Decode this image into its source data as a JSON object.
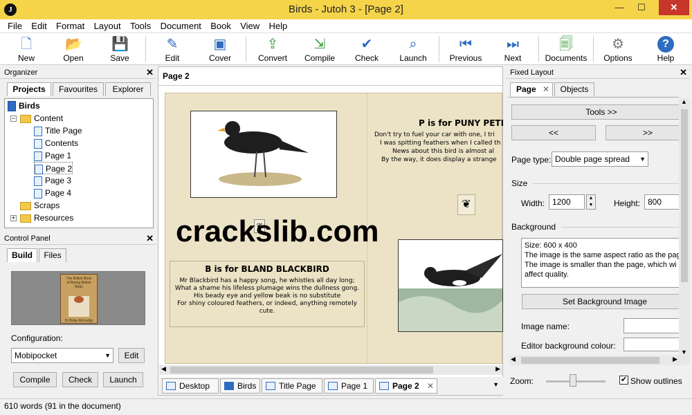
{
  "window": {
    "title": "Birds - Jutoh 3 - [Page 2]",
    "app_letter": "J",
    "minimize": "—",
    "maximize": "☐",
    "close": "✕"
  },
  "menu": [
    "File",
    "Edit",
    "Format",
    "Layout",
    "Tools",
    "Document",
    "Book",
    "View",
    "Help"
  ],
  "toolbar": [
    {
      "label": "New",
      "icon": "new-icon"
    },
    {
      "label": "Open",
      "icon": "open-folder-icon"
    },
    {
      "label": "Save",
      "icon": "save-icon"
    },
    {
      "label": "Edit",
      "icon": "edit-icon"
    },
    {
      "label": "Cover",
      "icon": "cover-icon"
    },
    {
      "label": "Convert",
      "icon": "convert-icon"
    },
    {
      "label": "Compile",
      "icon": "compile-icon"
    },
    {
      "label": "Check",
      "icon": "check-icon"
    },
    {
      "label": "Launch",
      "icon": "launch-icon"
    },
    {
      "label": "Previous",
      "icon": "previous-icon"
    },
    {
      "label": "Next",
      "icon": "next-icon"
    },
    {
      "label": "Documents",
      "icon": "documents-icon"
    },
    {
      "label": "Options",
      "icon": "options-icon"
    },
    {
      "label": "Help",
      "icon": "help-icon"
    }
  ],
  "organizer": {
    "title": "Organizer",
    "tabs": [
      "Projects",
      "Favourites",
      "Explorer"
    ],
    "tree": [
      {
        "label": "Birds",
        "type": "book"
      },
      {
        "label": "Content",
        "type": "folder"
      },
      {
        "label": "Title Page",
        "type": "page"
      },
      {
        "label": "Contents",
        "type": "page"
      },
      {
        "label": "Page 1",
        "type": "page"
      },
      {
        "label": "Page 2",
        "type": "page"
      },
      {
        "label": "Page 3",
        "type": "page"
      },
      {
        "label": "Page 4",
        "type": "page"
      },
      {
        "label": "Scraps",
        "type": "folder"
      },
      {
        "label": "Resources",
        "type": "folder"
      }
    ]
  },
  "control_panel": {
    "title": "Control Panel",
    "tabs": [
      "Build",
      "Files"
    ],
    "cover_lines": [
      "The British Book",
      "of Boring British",
      "Birds",
      "Dr Boba McFaddy"
    ],
    "config_label": "Configuration:",
    "config_value": "Mobipocket",
    "edit": "Edit",
    "compile": "Compile",
    "check": "Check",
    "launch": "Launch"
  },
  "editor": {
    "title": "Page 2",
    "left_heading": "B is for BLAND BLACKBIRD",
    "left_text": [
      "Mr Blackbird has a happy song, he whistles all day long;",
      "What a shame his lifeless plumage wins the dullness gong.",
      "His beady eye and yellow beak is no substitute",
      "For shiny coloured feathers, or indeed, anything remotely",
      "cute."
    ],
    "right_heading": "P is for PUNY PETI",
    "right_text": [
      "Don't try to fuel your car with one, I tri",
      "I was spitting feathers when I called th",
      "News about this bird is almost al",
      "By the way, it does display a strange"
    ],
    "watermark": "crackslib.com",
    "tabs": [
      "Desktop",
      "Birds",
      "Title Page",
      "Page 1",
      "Page 2"
    ]
  },
  "fixed_layout": {
    "title": "Fixed Layout",
    "tabs": [
      "Page",
      "Objects"
    ],
    "tools": "Tools >>",
    "prev": "<<",
    "next": ">>",
    "page_type_label": "Page type:",
    "page_type_value": "Double page spread",
    "size_label": "Size",
    "width_label": "Width:",
    "width_value": "1200",
    "height_label": "Height:",
    "height_value": "800",
    "background_label": "Background",
    "bg_info": [
      "Size: 600 x 400",
      "The image is the same aspect ratio as the pag",
      "The image is smaller than the page, which wi",
      "affect quality."
    ],
    "set_bg": "Set Background Image",
    "image_name_label": "Image name:",
    "editor_bg_label": "Editor background colour:",
    "zoom_label": "Zoom:",
    "zoom_level": 0.45,
    "show_outlines": "Show outlines"
  },
  "status": {
    "text": "610 words (91 in the document)"
  },
  "colors": {
    "titlebar": "#f5d44a",
    "close": "#c7362b",
    "accent": "#2e6cc0"
  }
}
